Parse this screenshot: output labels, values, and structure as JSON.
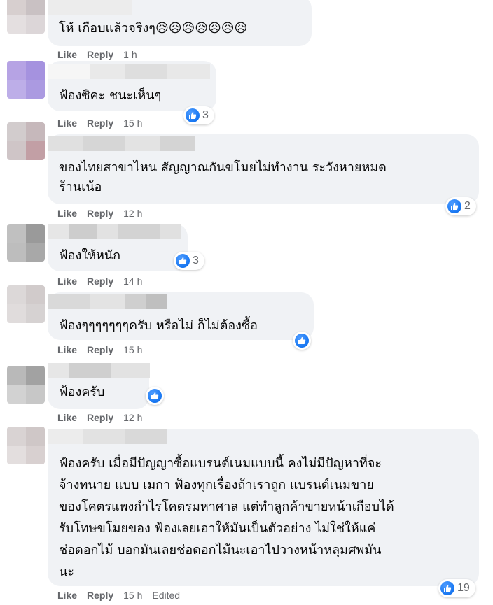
{
  "actions": {
    "like": "Like",
    "reply": "Reply",
    "edited": "Edited"
  },
  "colors": {
    "bubble": "#f0f2f5",
    "action_text": "#65676b",
    "like_blue": "#1877f2"
  },
  "comments": [
    {
      "text": "โห้ เกือบแล้วจริงๆ😥😥😥😥😥😥😥",
      "time": "1 h",
      "reactions": ""
    },
    {
      "text": "ฟ้องซิคะ ชนะเห็นๆ",
      "time": "15 h",
      "reactions": "3"
    },
    {
      "text": "ของไทยสาขาไหน สัญญาณกันขโมยไม่ทำงาน ระวังหายหมด\nร้านเน้อ",
      "time": "12 h",
      "reactions": "2"
    },
    {
      "text": "ฟ้องให้หนัก",
      "time": "14 h",
      "reactions": "3"
    },
    {
      "text": "ฟ้องๆๆๆๆๆๆๆครับ หรือไม่ ก็ไม่ต้องซื้อ",
      "time": "15 h",
      "reactions": ""
    },
    {
      "text": "ฟ้องครับ",
      "time": "12 h",
      "reactions": ""
    },
    {
      "text": "ฟ้องครับ เมื่อมีปัญญาซื้อแบรนด์เนมแบบนี้ คงไม่มีปัญหาที่จะ\nจ้างทนาย แบบ เมกา ฟ้องทุกเรื่องถ้าเราถูก แบรนด์เนมขาย\nของโคตรแพงกำไรโคตรมหาศาล แต่ทำลูกค้าขายหน้าเกือบได้\nรับโทษขโมยของ ฟ้องเลยเอาให้มันเป็นตัวอย่าง ไม่ใช่ให้แค่\nช่อดอกไม้ บอกมันเลยช่อดอกไม้นะเอาไปวางหน้าหลุมศพมัน\nนะ",
      "time": "15 h",
      "reactions": "19"
    }
  ]
}
